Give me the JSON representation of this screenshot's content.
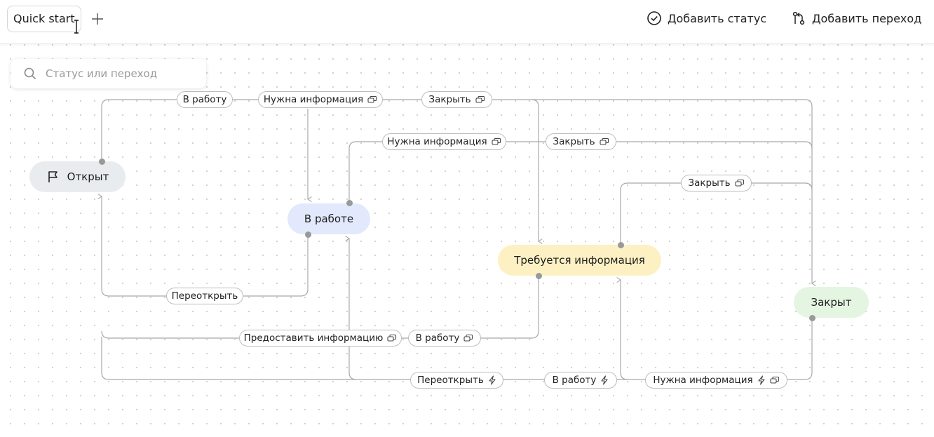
{
  "tab": {
    "label": "Quick start"
  },
  "actions": {
    "add_status": "Добавить статус",
    "add_transition": "Добавить переход"
  },
  "search": {
    "placeholder": "Статус или переход"
  },
  "statuses": {
    "open": "Открыт",
    "in_progress": "В работе",
    "need_info": "Требуется информация",
    "closed": "Закрыт"
  },
  "colors": {
    "open": "#e9ecef",
    "in_progress": "#e3e9fc",
    "need_info": "#fdf1c4",
    "closed": "#e4f6e2",
    "edge": "#a9a9a9"
  },
  "transitions": {
    "t1": "В работу",
    "t2": "Нужна информация",
    "t3": "Закрыть",
    "t4": "Нужна информация",
    "t5": "Закрыть",
    "t6": "Закрыть",
    "t7": "Переоткрыть",
    "t8": "Предоставить информацию",
    "t9": "В работу",
    "t10": "Переоткрыть",
    "t11": "В работу",
    "t12": "Нужна информация"
  }
}
